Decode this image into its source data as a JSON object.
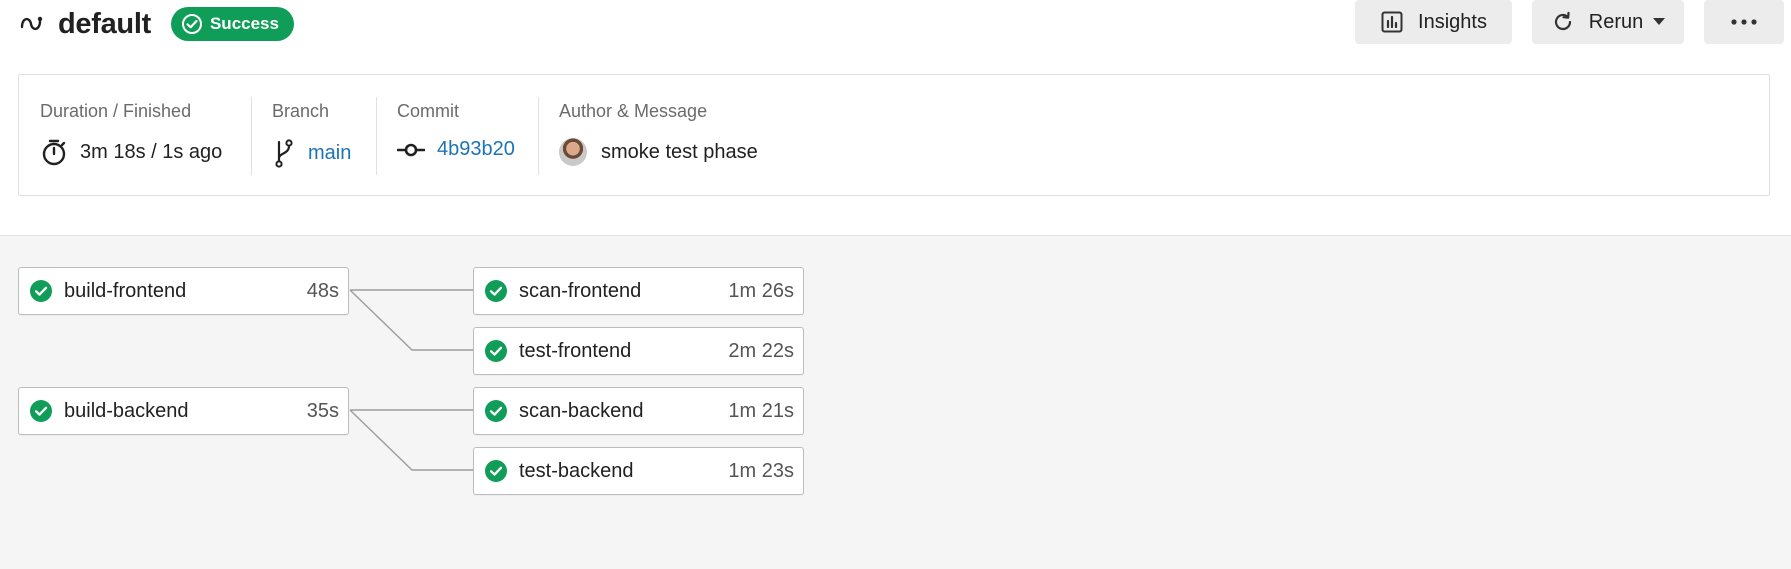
{
  "header": {
    "title": "default",
    "title_icon": "pipeline-squiggle-icon",
    "status": {
      "label": "Success",
      "color": "#0f9d58",
      "icon": "check-circle-icon"
    }
  },
  "toolbar": {
    "insights_label": "Insights",
    "insights_icon": "bar-chart-icon",
    "rerun_label": "Rerun",
    "rerun_icon": "refresh-icon",
    "more_icon": "more-horizontal-icon"
  },
  "summary": {
    "duration": {
      "label": "Duration / Finished",
      "value": "3m 18s / 1s ago",
      "icon": "stopwatch-icon"
    },
    "branch": {
      "label": "Branch",
      "value": "main",
      "icon": "branch-icon"
    },
    "commit": {
      "label": "Commit",
      "value": "4b93b20",
      "icon": "commit-icon"
    },
    "author": {
      "label": "Author & Message",
      "message": "smoke test phase",
      "icon": "avatar"
    }
  },
  "workflow": {
    "jobs": [
      {
        "name": "build-frontend",
        "duration": "48s",
        "status": "success"
      },
      {
        "name": "scan-frontend",
        "duration": "1m 26s",
        "status": "success"
      },
      {
        "name": "test-frontend",
        "duration": "2m 22s",
        "status": "success"
      },
      {
        "name": "build-backend",
        "duration": "35s",
        "status": "success"
      },
      {
        "name": "scan-backend",
        "duration": "1m 21s",
        "status": "success"
      },
      {
        "name": "test-backend",
        "duration": "1m 23s",
        "status": "success"
      }
    ],
    "colors": {
      "success": "#0f9d58",
      "link": "#1c73b8"
    }
  }
}
